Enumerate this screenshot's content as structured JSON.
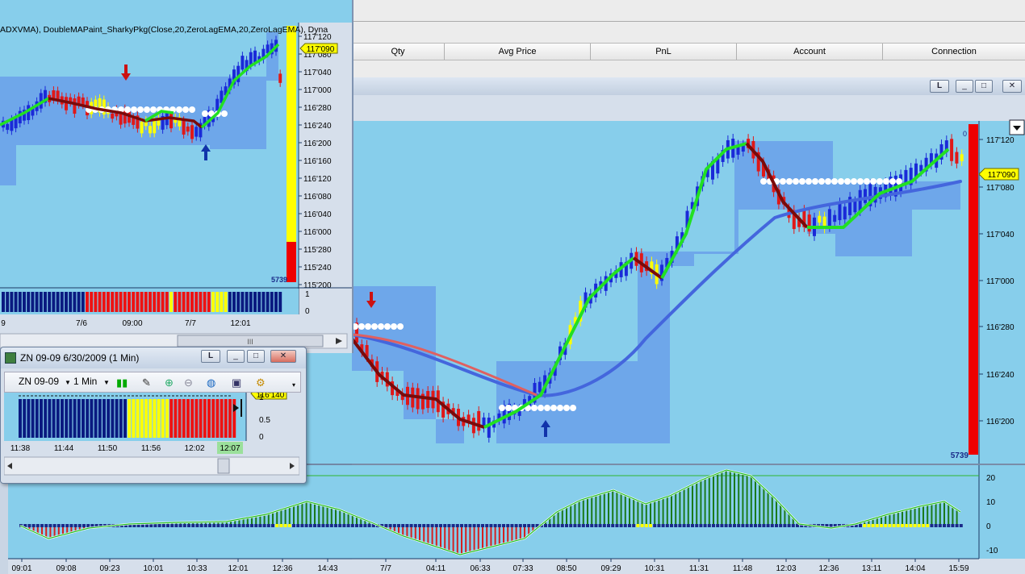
{
  "orders": {
    "columns": [
      "Qty",
      "Avg Price",
      "PnL",
      "Account",
      "Connection"
    ]
  },
  "main_chart": {
    "window_buttons": [
      "L",
      "_",
      "□",
      "✕"
    ],
    "price_ticks": [
      "117'120",
      "117'080",
      "117'040",
      "117'000",
      "116'280",
      "116'240",
      "116'200"
    ],
    "current_price": "117'090",
    "volume_label": "5739",
    "corner_zero": "0",
    "osc_ticks": [
      "20",
      "10",
      "0",
      "-10"
    ],
    "time_labels": [
      "09:01",
      "09:08",
      "09:23",
      "10:01",
      "10:33",
      "12:01",
      "12:36",
      "14:43",
      "7/7",
      "04:11",
      "06:33",
      "07:33",
      "08:50",
      "09:29",
      "10:31",
      "11:31",
      "11:48",
      "12:03",
      "12:36",
      "13:11",
      "14:04",
      "15:59"
    ],
    "colors": {
      "background": "#87ceeb",
      "up_bar": "#1a2ad8",
      "down_bar": "#e01818",
      "neutral_bar": "#ffff00",
      "band": "#6aa0ea",
      "ma_up": "#22e022",
      "ma_down": "#7a0a0a",
      "slow_ma": "#4466dd"
    }
  },
  "left_chart": {
    "indicator_text": "ADXVMA), DoubleMAPaint_SharkyPkg(Close,20,ZeroLagEMA,20,ZeroLagEMA), Dyna",
    "price_ticks": [
      "117'120",
      "117'080",
      "117'040",
      "117'000",
      "116'280",
      "116'240",
      "116'200",
      "116'160",
      "116'120",
      "116'080",
      "116'040",
      "116'000",
      "115'280",
      "115'240",
      "115'200"
    ],
    "current_price": "117'090",
    "volume_label": "5739",
    "sub_ticks": [
      "1",
      "0"
    ],
    "time_labels": [
      "9",
      "7/6",
      "09:00",
      "7/7",
      "12:01"
    ],
    "scroll_glyph": "III"
  },
  "mini_window": {
    "title": "ZN 09-09  6/30/2009 (1 Min)",
    "title_buttons": [
      "L",
      "_",
      "□",
      "✕"
    ],
    "instrument": "ZN 09-09",
    "interval": "1 Min",
    "price_tag": "116'140",
    "y_ticks": [
      "1",
      "0.5",
      "0"
    ],
    "time_labels": [
      "11:38",
      "11:44",
      "11:50",
      "11:56",
      "12:02",
      "12:07"
    ]
  }
}
